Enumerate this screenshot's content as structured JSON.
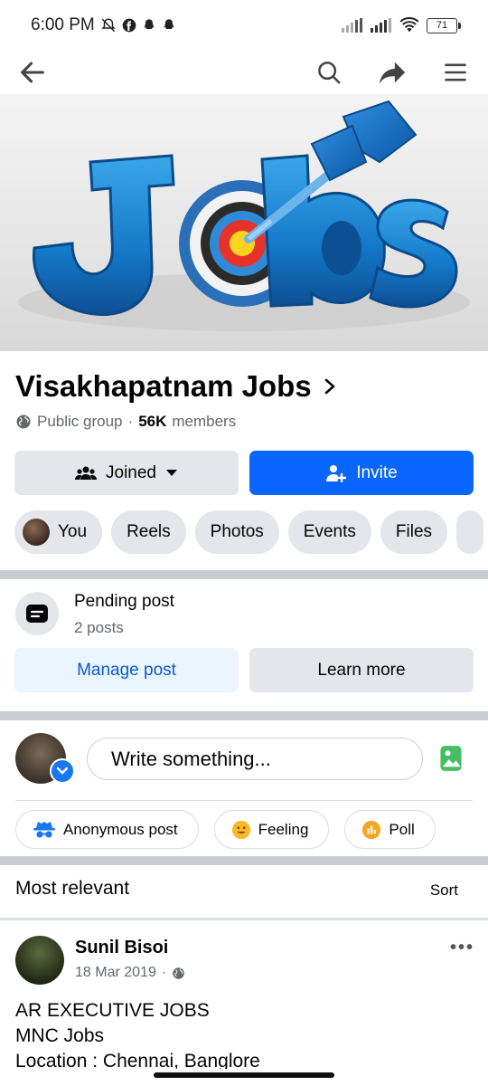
{
  "status_bar": {
    "time": "6:00 PM",
    "battery": "71"
  },
  "group": {
    "name": "Visakhapatnam Jobs",
    "privacy": "Public group",
    "separator": "·",
    "member_count": "56K",
    "member_label": "members",
    "cover_text": "Jobs"
  },
  "buttons": {
    "joined": "Joined",
    "invite": "Invite"
  },
  "chips": [
    "You",
    "Reels",
    "Photos",
    "Events",
    "Files"
  ],
  "pending": {
    "title": "Pending post",
    "subtitle": "2 posts",
    "manage": "Manage post",
    "learn_more": "Learn more"
  },
  "composer": {
    "placeholder": "Write something...",
    "actions": [
      "Anonymous post",
      "Feeling",
      "Poll"
    ]
  },
  "feed": {
    "section_title": "Most relevant",
    "sort_label": "Sort"
  },
  "post": {
    "author": "Sunil Bisoi",
    "date": "18 Mar 2019",
    "date_separator": "·",
    "more": "•••",
    "lines": [
      "AR EXECUTIVE JOBS",
      "MNC Jobs",
      "Location : Chennai, Banglore"
    ]
  },
  "colors": {
    "primary_blue": "#0866ff",
    "link_blue": "#0a5ad1",
    "chip_gray": "#e4e6eb"
  }
}
